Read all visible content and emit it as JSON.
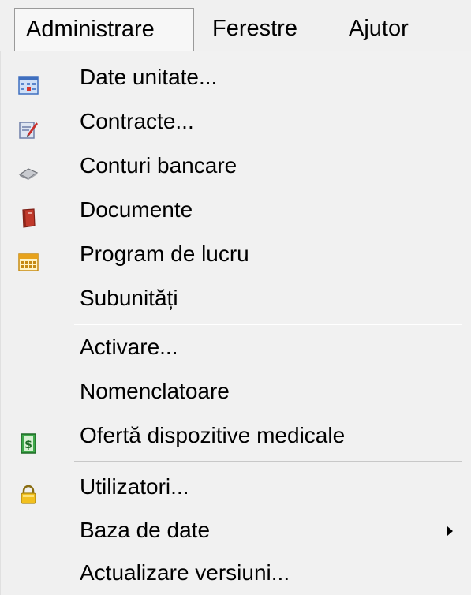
{
  "menubar": {
    "items": [
      {
        "label": "Administrare",
        "active": true
      },
      {
        "label": "Ferestre"
      },
      {
        "label": "Ajutor"
      }
    ]
  },
  "dropdown": {
    "items": [
      {
        "label": "Date unitate...",
        "icon": "calendar-grid-icon"
      },
      {
        "label": "Contracte...",
        "icon": "contract-edit-icon"
      },
      {
        "label": "Conturi bancare",
        "icon": "bank-card-icon"
      },
      {
        "label": "Documente",
        "icon": "document-book-icon"
      },
      {
        "label": "Program de lucru",
        "icon": "calendar-schedule-icon"
      },
      {
        "label": "Subunități",
        "icon": ""
      },
      {
        "label": "Activare...",
        "icon": ""
      },
      {
        "label": "Nomenclatoare",
        "icon": ""
      },
      {
        "label": "Ofertă dispozitive medicale",
        "icon": "dollar-bill-icon"
      },
      {
        "label": "Utilizatori...",
        "icon": "padlock-icon"
      },
      {
        "label": "Baza de date",
        "icon": "",
        "submenu": true
      },
      {
        "label": "Actualizare versiuni...",
        "icon": ""
      }
    ]
  },
  "colors": {
    "menu_background": "#f0f0f0",
    "active_menu_border": "#9a9a9a",
    "separator": "#c8c8c8"
  }
}
